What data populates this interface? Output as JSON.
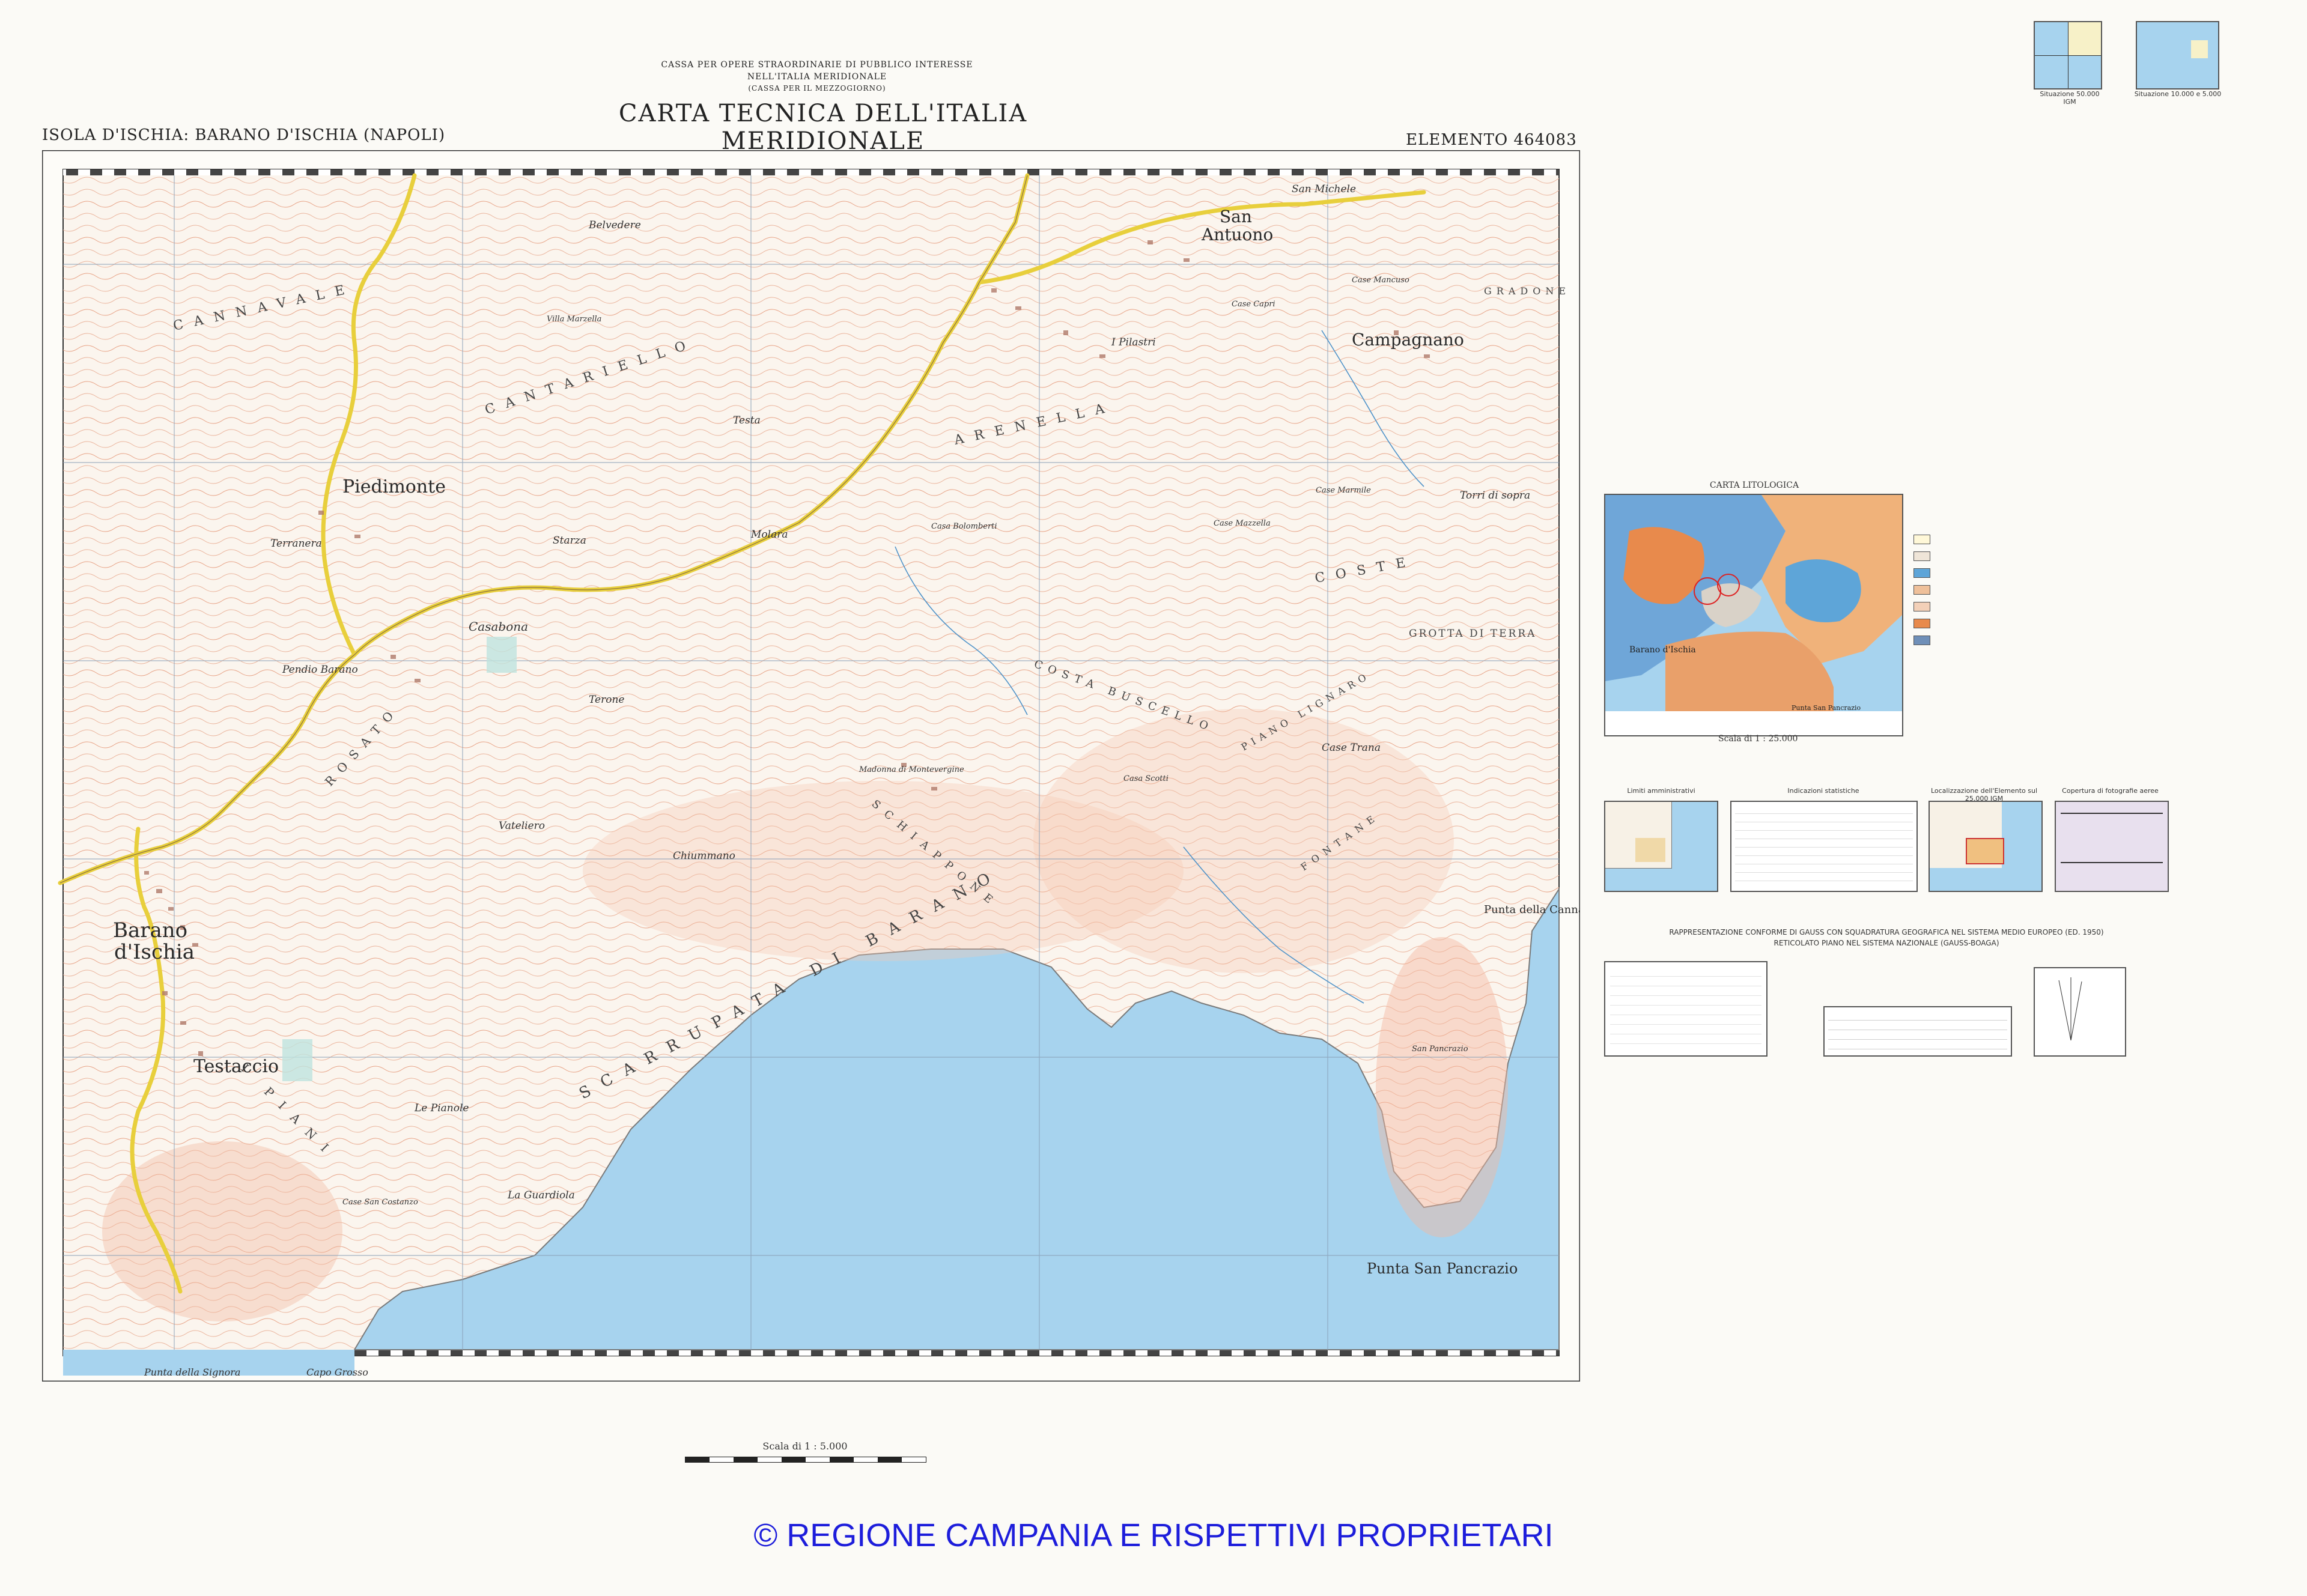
{
  "header": {
    "agency_line1": "CASSA PER OPERE STRAORDINARIE DI PUBBLICO INTERESSE",
    "agency_line2": "NELL'ITALIA MERIDIONALE",
    "agency_line3": "(CASSA PER IL MEZZOGIORNO)",
    "title": "CARTA TECNICA DELL'ITALIA MERIDIONALE",
    "subtitle": "ISOLA D'ISCHIA: BARANO D'ISCHIA (NAPOLI)",
    "elemento": "ELEMENTO  464083"
  },
  "map": {
    "places_major": [
      "San Antuono",
      "Campagnano",
      "Piedimonte",
      "Barano d'Ischia",
      "Testaccio",
      "Punta San Pancrazio",
      "Punta della Cannaccia"
    ],
    "places_minor": [
      "Belvedere",
      "I Pilastri",
      "Testa",
      "Casabona",
      "Starza",
      "Molara",
      "Terone",
      "Vateliero",
      "Chiummano",
      "Terranera",
      "Pendio Barano",
      "Madonna di Montevergine",
      "Case Trana",
      "Torri di sopra",
      "Le Pianole",
      "Case San Costanzo",
      "La Guardiola",
      "San Michele",
      "Case Mancuso",
      "Case Capri",
      "Villa Marzella",
      "Case Marmile",
      "Case Mazzella",
      "San Pancrazio",
      "Casa Scotti",
      "Casa Bolomberti"
    ],
    "regions": [
      "CANNAVALE",
      "CANTARIELLO",
      "ARENELLA",
      "COSTE",
      "GRADONE",
      "GROTTA DI TERRA",
      "COSTA BUSCELLO",
      "SCHIAPPONE",
      "SCARRUPATA DI BARANO",
      "PIANO LIGNARO",
      "ROSATO",
      "FONTANE",
      "I PIANI"
    ],
    "coast_labels": [
      "Punta della Signora",
      "Capo Grosso"
    ]
  },
  "litho": {
    "title": "CARTA LITOLOGICA",
    "scale": "Scala di 1 : 25.000"
  },
  "panels": [
    "Limiti amministrativi",
    "Indicazioni statistiche",
    "Localizzazione dell'Elemento sul 25.000 IGM",
    "Copertura di fotografie aeree"
  ],
  "projection": {
    "line1": "RAPPRESENTAZIONE CONFORME DI GAUSS CON SQUADRATURA GEOGRAFICA NEL SISTEMA MEDIO EUROPEO (ED. 1950)",
    "line2": "RETICOLATO PIANO NEL SISTEMA NAZIONALE (GAUSS-BOAGA)"
  },
  "index": {
    "caption1": "Situazione 50.000 IGM",
    "caption2": "Situazione 10.000 e 5.000"
  },
  "scale_bar": "Scala di 1 : 5.000",
  "copyright": "© REGIONE CAMPANIA E RISPETTIVI PROPRIETARI",
  "colors": {
    "sea": "#a7d3ee",
    "contour": "#e08a62",
    "road": "#e8cf3c",
    "paper": "#fbfaf6",
    "copyright": "#1d1ddb"
  }
}
